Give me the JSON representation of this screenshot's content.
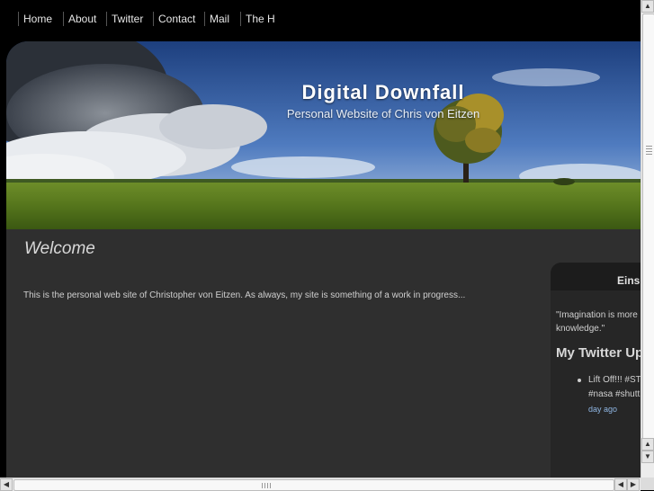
{
  "nav": {
    "items": [
      {
        "label": "Home"
      },
      {
        "label": "About"
      },
      {
        "label": "Twitter"
      },
      {
        "label": "Contact"
      },
      {
        "label": "Mail"
      },
      {
        "label": "The H"
      }
    ]
  },
  "header": {
    "title": "Digital Downfall",
    "subtitle": "Personal Website of Chris von Eitzen"
  },
  "main": {
    "heading": "Welcome",
    "intro": "This is the personal web site of Christopher von Eitzen. As always, my site is something of a work in progress..."
  },
  "sidebar": {
    "box_title": "Eins",
    "quote_line1": "\"Imagination is more i",
    "quote_line2": "knowledge.\"",
    "twitter_heading": "My Twitter Up",
    "tweet_line1": "Lift Off!!! #ST",
    "tweet_line2": "#nasa #shutt",
    "tweet_time": "day ago"
  },
  "scrollbars": {
    "up_arrow": "▲",
    "down_arrow": "▼",
    "left_arrow": "◀",
    "right_arrow": "▶"
  }
}
